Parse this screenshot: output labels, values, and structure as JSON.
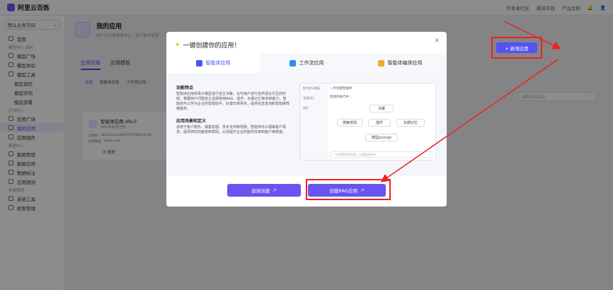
{
  "topbar": {
    "logo": "阿里云百炼",
    "links": [
      "开发者社区",
      "最佳实践",
      "产品文档"
    ]
  },
  "sidebar": {
    "space": "默认业务空间",
    "items": [
      {
        "type": "item",
        "label": "首页"
      },
      {
        "type": "group",
        "label": "模型中心 虚拟"
      },
      {
        "type": "item",
        "label": "模型广场"
      },
      {
        "type": "item",
        "label": "模型体验"
      },
      {
        "type": "item",
        "label": "模型工具"
      },
      {
        "type": "sub",
        "label": "模型调优"
      },
      {
        "type": "sub",
        "label": "模型评测"
      },
      {
        "type": "sub",
        "label": "模型部署"
      },
      {
        "type": "group",
        "label": "应用中心"
      },
      {
        "type": "item",
        "label": "应用广场"
      },
      {
        "type": "item",
        "label": "我的应用",
        "active": true
      },
      {
        "type": "item",
        "label": "应用组件"
      },
      {
        "type": "group",
        "label": "数据中心"
      },
      {
        "type": "item",
        "label": "数据管理"
      },
      {
        "type": "item",
        "label": "数据应用"
      },
      {
        "type": "item",
        "label": "数据标注"
      },
      {
        "type": "item",
        "label": "应用观测"
      },
      {
        "type": "group",
        "label": "系统管理"
      },
      {
        "type": "item",
        "label": "系统工具"
      },
      {
        "type": "item",
        "label": "权限管理"
      }
    ]
  },
  "main": {
    "title": "我的应用",
    "subtitle": "用户的应用管理中心，用于集中管理",
    "tabs": [
      "应用列表",
      "应用模板"
    ],
    "filters": [
      "全部",
      "智能体应用",
      "工作流应用"
    ],
    "new_button": "+ 新增应用",
    "search_placeholder": "搜索应用名称",
    "card": {
      "name": "智能体应用-d9u7",
      "type": "RAG智能体应用",
      "id_label": "应用ID",
      "id_value": "8b41b110a2084370000612748",
      "model_label": "应用模型",
      "model_value": "qwen-max",
      "manage": "管理"
    }
  },
  "modal": {
    "title": "一键创建你的应用！",
    "tabs": [
      {
        "label": "智能体应用",
        "color": "#4955f5",
        "active": true
      },
      {
        "label": "工作流应用",
        "color": "#2d8cf0",
        "active": false
      },
      {
        "label": "智能体编排应用",
        "color": "#f5a623",
        "active": false
      }
    ],
    "feature_title": "功能特点",
    "feature_text": "智能体应用依靠大模型进行自主决策，在与用户进行自然语言交互的时候，根据用户问题自主选择使用RAG、插件、长期记忆等多种能力。智能体可以作为企业的智能助手，处理日常事务，提供信息查询和智能推荐等服务。",
    "scenario_title": "应用场景和定义",
    "scenario_text": "适用于客户服务、销售助理、技术支持等场景。智能体可以理解客户需求，提供即时的解答和帮助，从而提升企业的服务效率和客户满意度。",
    "preview": {
      "side": [
        "指令提示模板",
        "长期记忆",
        "插件"
      ],
      "header": "一步创建智能体",
      "status": "智能体执行中...",
      "nodes": [
        "决策",
        "搜索增强",
        "插件",
        "长期记忆",
        "模型prompt"
      ],
      "footer": "一步创建你的应用，让智能体协作"
    },
    "btn_direct": "直接创建",
    "btn_rag": "创建RAG应用"
  }
}
